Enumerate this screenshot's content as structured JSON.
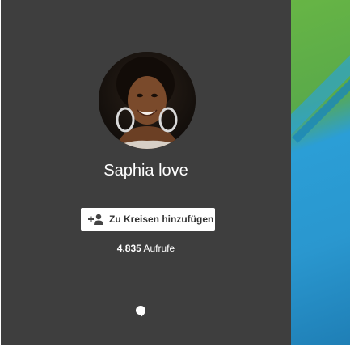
{
  "profile": {
    "name": "Saphia love",
    "add_button_label": "Zu Kreisen hinzufügen",
    "add_button_icon": "person-add-icon",
    "views_count": "4.835",
    "views_label": "Aufrufe",
    "hangout_icon": "hangout-icon"
  },
  "colors": {
    "panel_background": "#3e3e3e",
    "text": "#ffffff",
    "button_background": "#ffffff",
    "button_text": "#333333",
    "cover_green": "#67b545",
    "cover_blue": "#2a97cf"
  }
}
